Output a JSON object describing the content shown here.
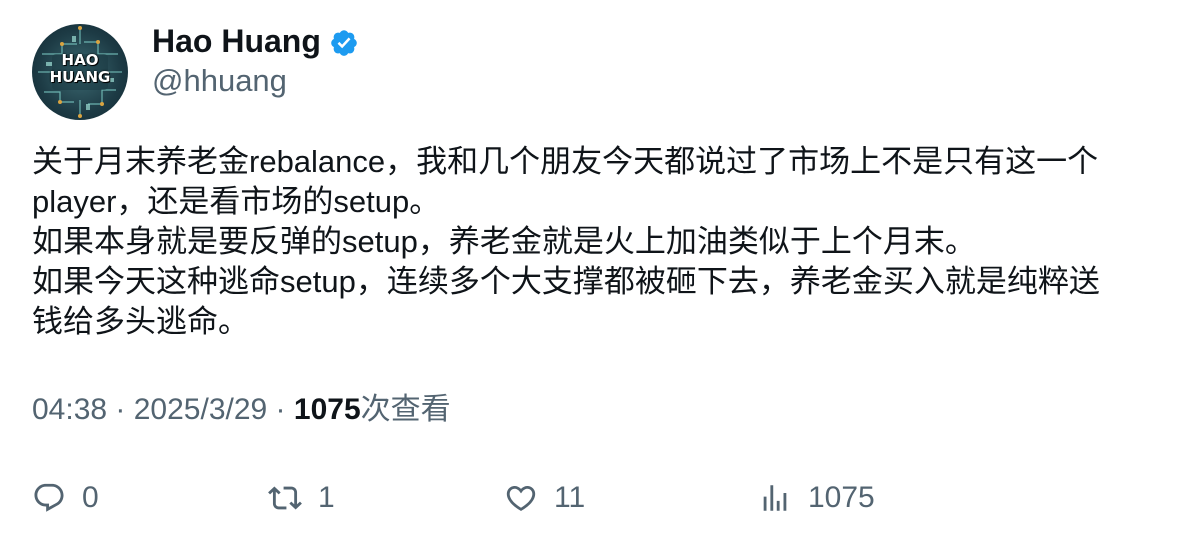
{
  "author": {
    "display_name": "Hao Huang",
    "handle": "@hhuang",
    "verified": true,
    "avatar_text": [
      "HAO",
      "HUANG"
    ]
  },
  "tweet": {
    "lines": [
      "关于月末养老金rebalance，我和几个朋友今天都说过了市场上不是只有这一个",
      "player，还是看市场的setup。",
      "如果本身就是要反弹的setup，养老金就是火上加油类似于上个月末。",
      "如果今天这种逃命setup，连续多个大支撑都被砸下去，养老金买入就是纯粹送",
      "钱给多头逃命。"
    ]
  },
  "meta": {
    "time": "04:38",
    "separator": " · ",
    "date": "2025/3/29",
    "views_count": "1075",
    "views_label": "次查看"
  },
  "actions": {
    "reply_count": "0",
    "retweet_count": "1",
    "like_count": "11",
    "views_count": "1075"
  },
  "colors": {
    "text": "#0f1419",
    "secondary": "#536471",
    "verified": "#1d9bf0"
  }
}
